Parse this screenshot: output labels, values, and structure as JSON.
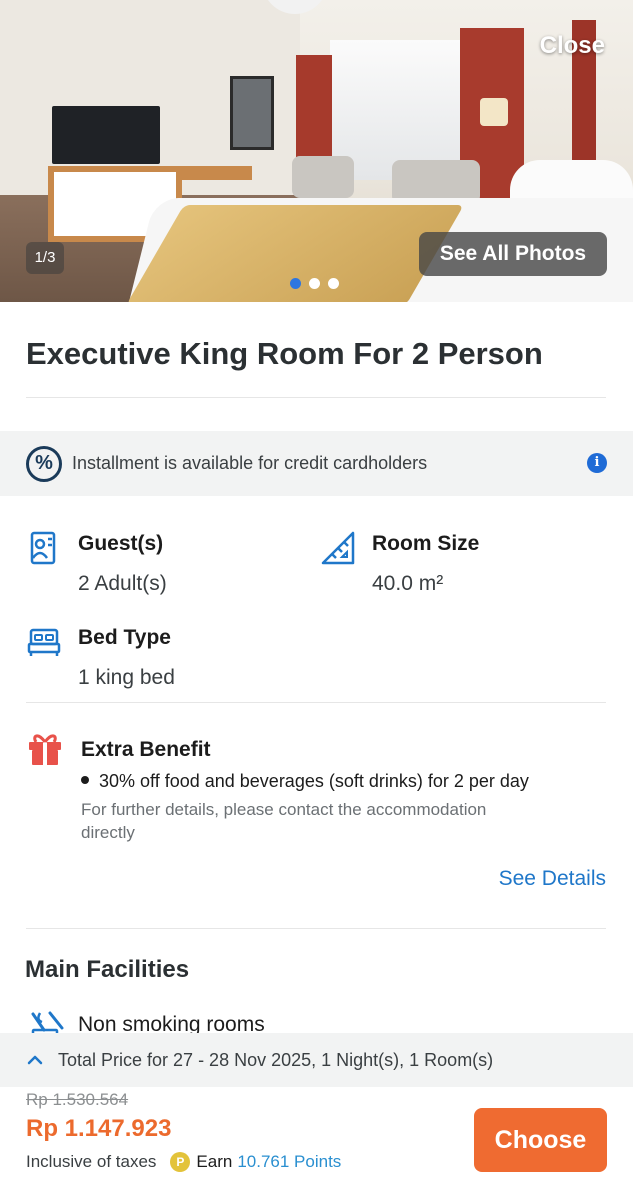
{
  "header": {
    "close_label": "Close",
    "photo_counter": "1/3",
    "see_all_photos_label": "See All Photos",
    "carousel": {
      "total": 3,
      "active_index": 0
    }
  },
  "room": {
    "title": "Executive King Room For 2 Person"
  },
  "installment": {
    "text": "Installment is available for credit cardholders",
    "icon": "percent-icon",
    "info_icon": "info-icon"
  },
  "specs": {
    "guests": {
      "label": "Guest(s)",
      "value": "2 Adult(s)",
      "icon": "guest-icon"
    },
    "room_size": {
      "label": "Room Size",
      "value": "40.0 m²",
      "icon": "ruler-icon"
    },
    "bed_type": {
      "label": "Bed Type",
      "value": "1 king bed",
      "icon": "bed-icon"
    }
  },
  "benefit": {
    "title": "Extra Benefit",
    "item": "30% off food and beverages (soft drinks) for 2 per day",
    "note": "For further details, please contact the accommodation directly",
    "see_details_label": "See Details",
    "icon": "gift-icon"
  },
  "facilities": {
    "title": "Main Facilities",
    "items": [
      {
        "label": "Non smoking rooms",
        "icon": "no-smoking-icon"
      }
    ]
  },
  "booking": {
    "total_price_label": "Total Price for 27 - 28 Nov 2025, 1 Night(s), 1 Room(s)",
    "original_price": "Rp 1.530.564",
    "price": "Rp 1.147.923",
    "tax_note": "Inclusive of taxes",
    "earn_label": "Earn",
    "points": "10.761 Points",
    "choose_label": "Choose"
  },
  "colors": {
    "accent_orange": "#ef6b31",
    "price_orange": "#ec6a2d",
    "link_blue": "#1f77c9",
    "active_dot": "#2d76e0",
    "icon_blue": "#1f77c9",
    "gift_red": "#e8524a"
  }
}
